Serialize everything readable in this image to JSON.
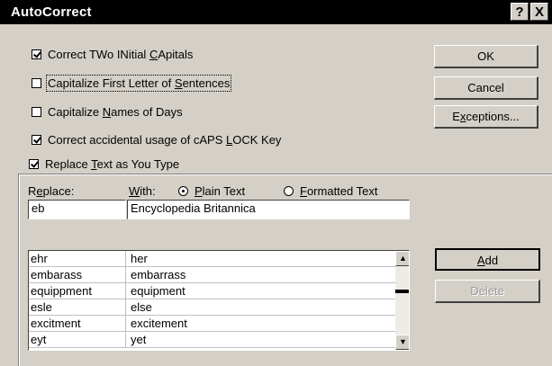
{
  "window": {
    "title": "AutoCorrect",
    "help_button": "?",
    "close_button": "X"
  },
  "options": [
    {
      "pre": "Correct TWo INitial ",
      "key": "C",
      "post": "Apitals",
      "checked": true
    },
    {
      "pre": "Capitalize First Letter of ",
      "key": "S",
      "post": "entences",
      "checked": false
    },
    {
      "pre": "Capitalize ",
      "key": "N",
      "post": "ames of Days",
      "checked": false
    },
    {
      "pre": "Correct accidental usage of cAPS ",
      "key": "L",
      "post": "OCK Key",
      "checked": true
    }
  ],
  "buttons": {
    "ok": "OK",
    "cancel": "Cancel",
    "exceptions_pre": "E",
    "exceptions_key": "x",
    "exceptions_post": "ceptions...",
    "add_key": "A",
    "add_post": "dd",
    "delete": "Delete"
  },
  "replace_group": {
    "pre": "Replace ",
    "key": "T",
    "post": "ext as You Type",
    "checked": true
  },
  "labels": {
    "replace_pre": "R",
    "replace_key": "e",
    "replace_post": "place:",
    "with_key": "W",
    "with_post": "ith:",
    "plain_key": "P",
    "plain_post": "lain Text",
    "formatted_key": "F",
    "formatted_post": "ormatted Text"
  },
  "radio_selected": "plain",
  "fields": {
    "replace_value": "eb",
    "with_value": "Encyclopedia Britannica"
  },
  "entries": [
    {
      "replace": "ehr",
      "with": "her"
    },
    {
      "replace": "embarass",
      "with": "embarrass"
    },
    {
      "replace": "equippment",
      "with": "equipment"
    },
    {
      "replace": "esle",
      "with": "else"
    },
    {
      "replace": "excitment",
      "with": "excitement"
    },
    {
      "replace": "eyt",
      "with": "yet"
    }
  ],
  "scrollbar": {
    "up_icon": "arrow-up-icon",
    "down_icon": "arrow-down-icon"
  }
}
